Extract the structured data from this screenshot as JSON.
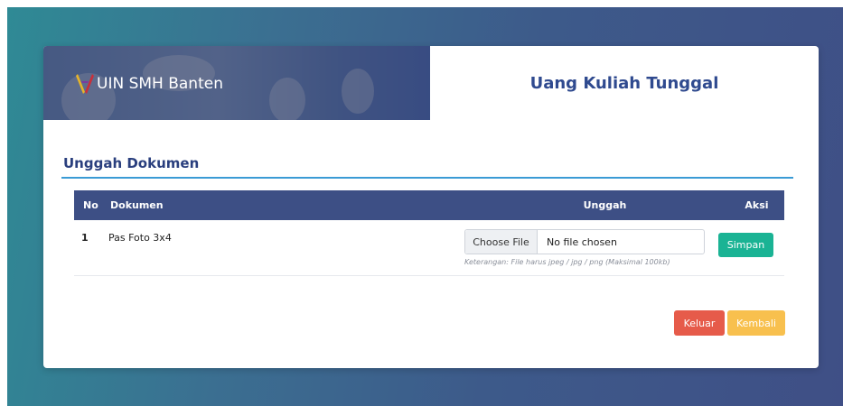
{
  "header": {
    "brand_name": "UIN SMH Banten",
    "logo_icon": "uin-logo-icon",
    "app_title": "Uang Kuliah Tunggal"
  },
  "section": {
    "title": "Unggah Dokumen"
  },
  "table": {
    "columns": [
      "No",
      "Dokumen",
      "Unggah",
      "Aksi"
    ],
    "rows": [
      {
        "no": "1",
        "dokumen": "Pas Foto 3x4",
        "file_button_label": "Choose File",
        "file_status": "No file chosen",
        "note": "Keterangan: File harus jpeg / jpg / png (Maksimal 100kb)",
        "action_label": "Simpan"
      }
    ]
  },
  "footer": {
    "keluar_label": "Keluar",
    "kembali_label": "Kembali"
  },
  "colors": {
    "primary": "#3d4f85",
    "success": "#1ab394",
    "danger": "#e65b4a",
    "warning": "#f8c04e",
    "accent_line": "#3a9bd5"
  }
}
